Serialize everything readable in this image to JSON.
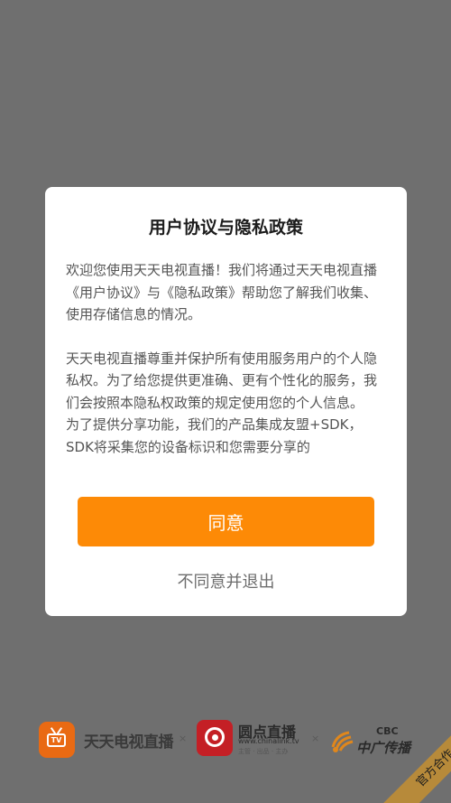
{
  "dialog": {
    "title": "用户协议与隐私政策",
    "paragraph_1": "欢迎您使用天天电视直播！我们将通过天天电视直播《用户协议》与《隐私政策》帮助您了解我们收集、使用存储信息的情况。",
    "paragraph_2": "天天电视直播尊重并保护所有使用服务用户的个人隐私权。为了给您提供更准确、更有个性化的服务，我们会按照本隐私权政策的规定使用您的个人信息。",
    "paragraph_3": "为了提供分享功能，我们的产品集成友盟+SDK，SDK将采集您的设备标识和您需要分享的",
    "agree_label": "同意",
    "decline_label": "不同意并退出"
  },
  "footer": {
    "logo_1_name": "天天电视直播",
    "logo_1_icon_text": "TV",
    "separator": "×",
    "logo_2_name": "圆点直播",
    "logo_2_url": "www.chinalink.tv",
    "logo_2_sub": "主管 · 出品 · 主办",
    "logo_3_en": "CBC",
    "logo_3_zh": "中广传播",
    "ribbon_label": "官方合作"
  },
  "colors": {
    "overlay": "#6f6f6f",
    "accent": "#fd8a06",
    "ribbon": "#b78a3a"
  },
  "icons": [
    "tv-icon",
    "ydzb-logo-icon",
    "cbc-logo-icon"
  ]
}
